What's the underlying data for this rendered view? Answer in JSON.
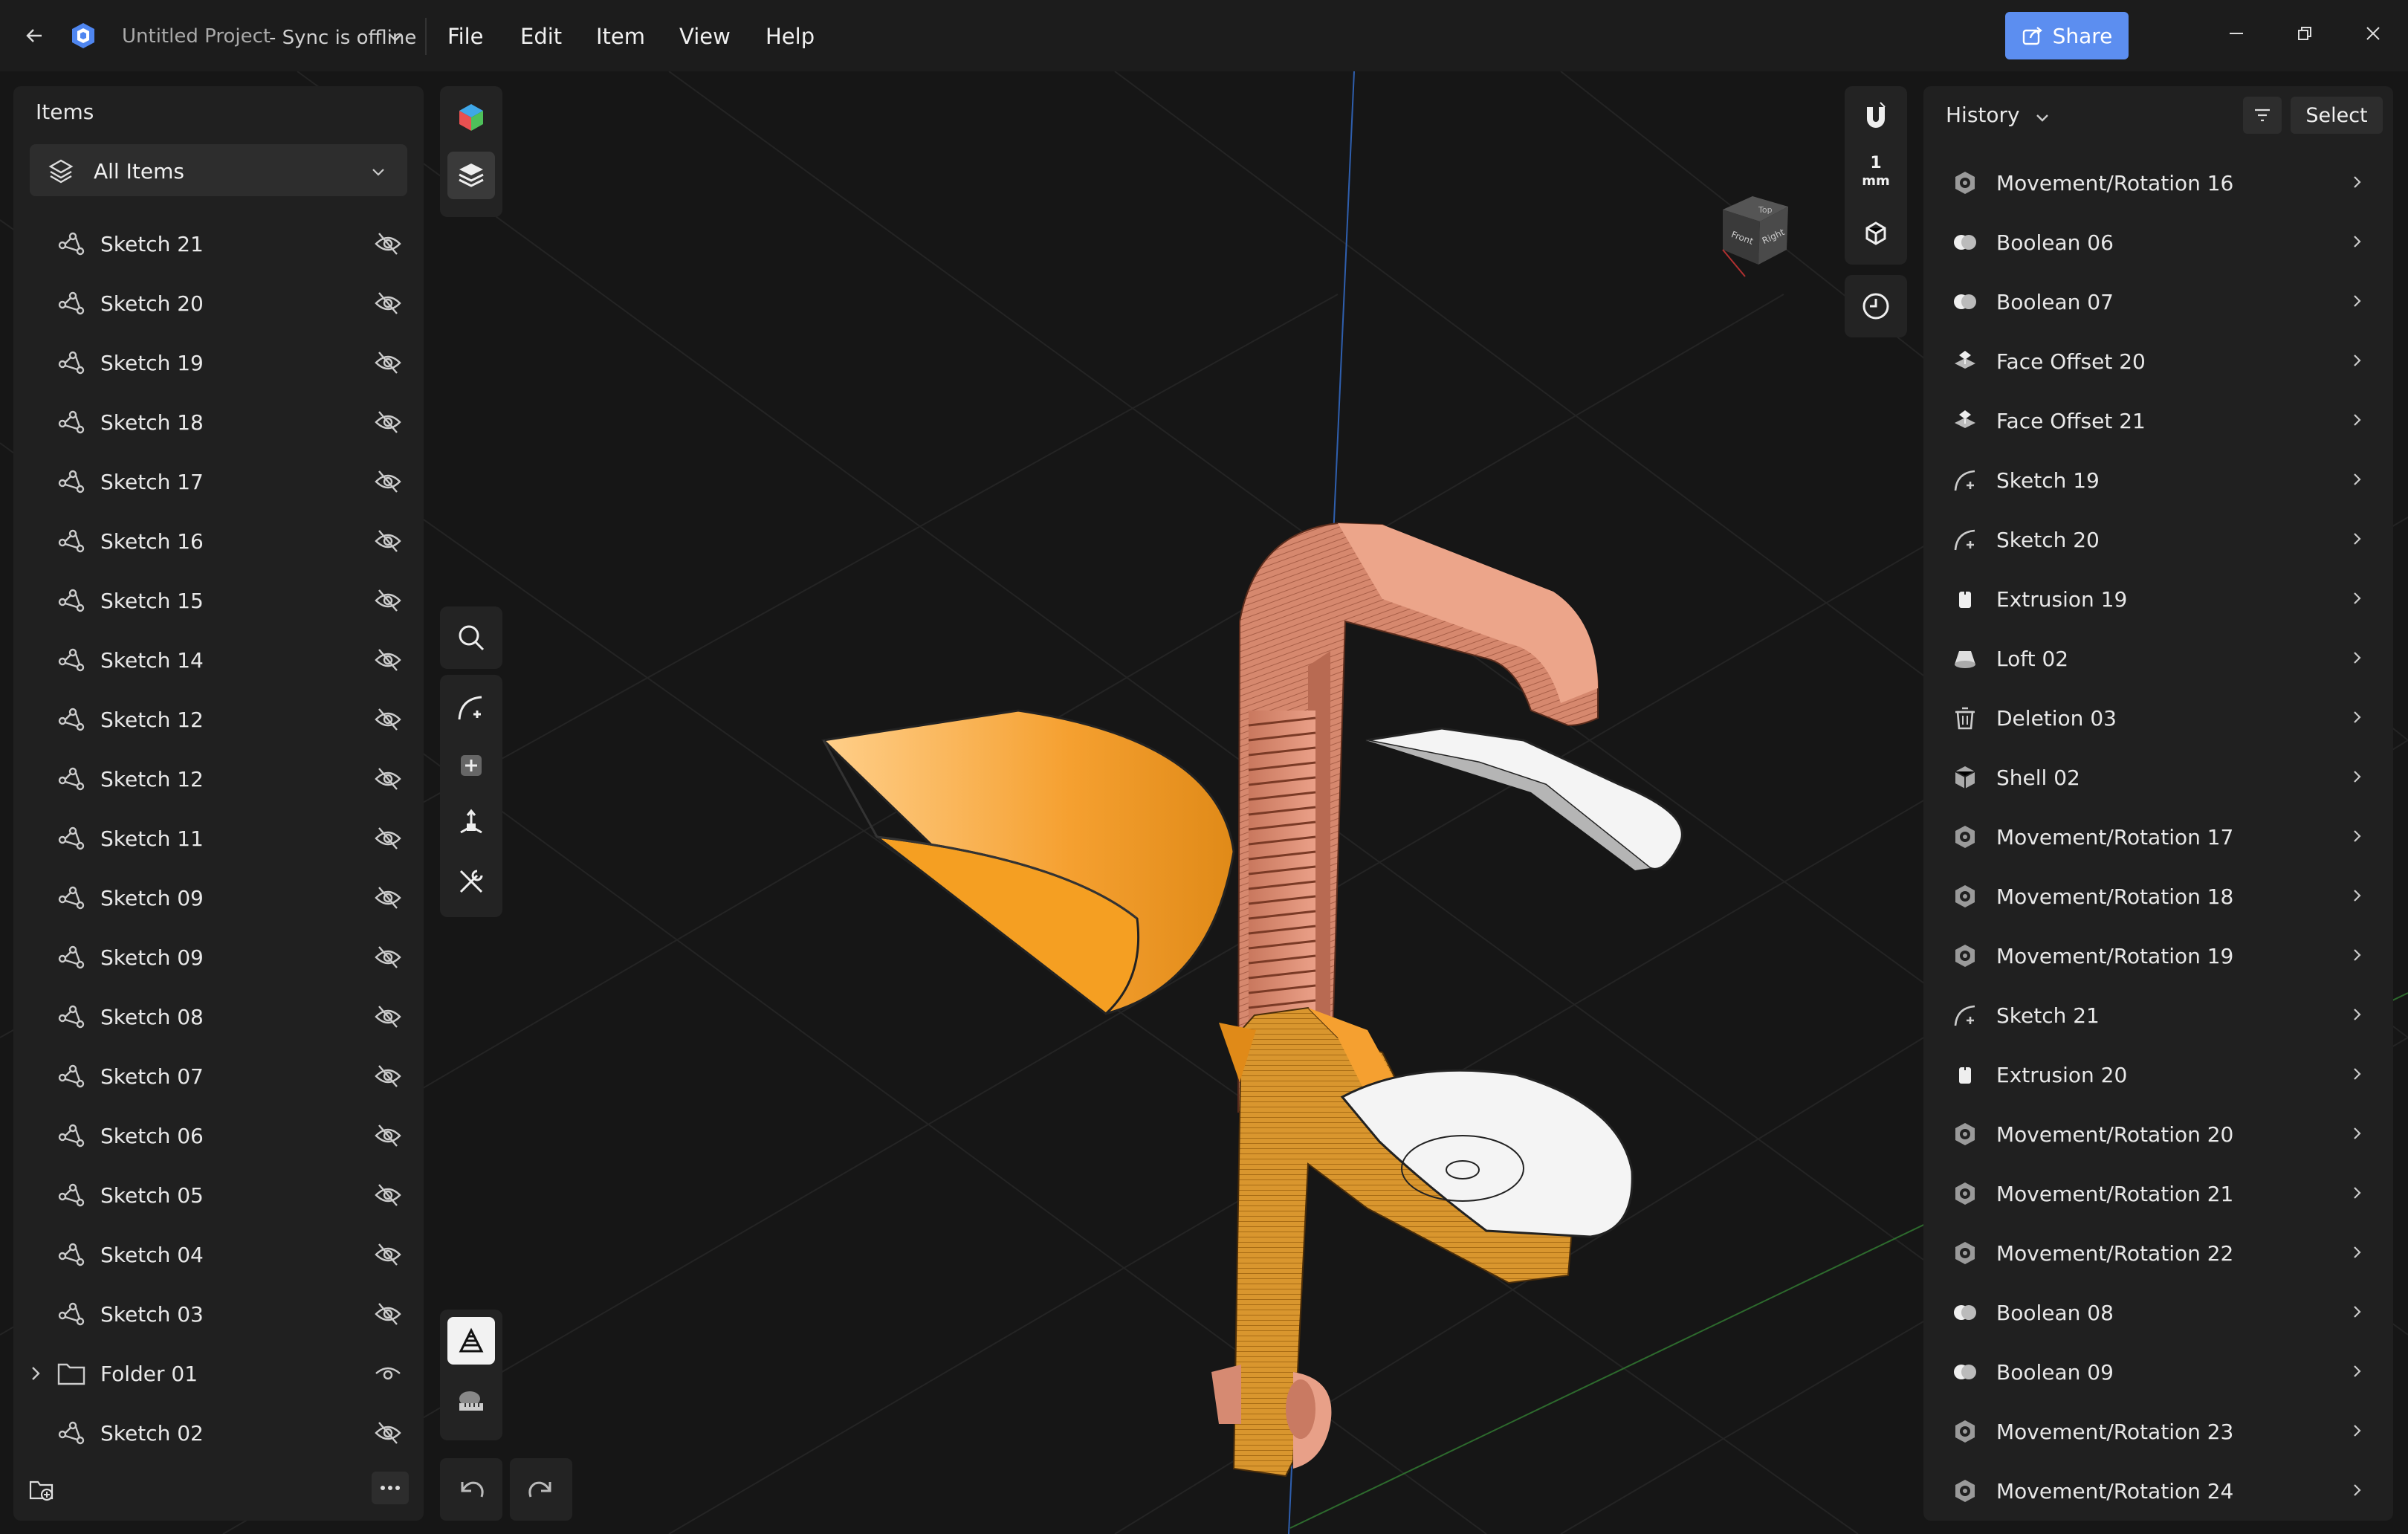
{
  "titlebar": {
    "project_name": "Untitled Project",
    "sync_status": "- Sync is offline",
    "menu": [
      "File",
      "Edit",
      "Item",
      "View",
      "Help"
    ],
    "share_label": "Share"
  },
  "left_panel": {
    "title": "Items",
    "filter_label": "All Items",
    "items": [
      {
        "label": "Sketch 21",
        "visible": false
      },
      {
        "label": "Sketch 20",
        "visible": false
      },
      {
        "label": "Sketch 19",
        "visible": false
      },
      {
        "label": "Sketch 18",
        "visible": false
      },
      {
        "label": "Sketch 17",
        "visible": false
      },
      {
        "label": "Sketch 16",
        "visible": false
      },
      {
        "label": "Sketch 15",
        "visible": false
      },
      {
        "label": "Sketch 14",
        "visible": false
      },
      {
        "label": "Sketch 12",
        "visible": false
      },
      {
        "label": "Sketch 12",
        "visible": false
      },
      {
        "label": "Sketch 11",
        "visible": false
      },
      {
        "label": "Sketch 09",
        "visible": false
      },
      {
        "label": "Sketch 09",
        "visible": false
      },
      {
        "label": "Sketch 08",
        "visible": false
      },
      {
        "label": "Sketch 07",
        "visible": false
      },
      {
        "label": "Sketch 06",
        "visible": false
      },
      {
        "label": "Sketch 05",
        "visible": false
      },
      {
        "label": "Sketch 04",
        "visible": false
      },
      {
        "label": "Sketch 03",
        "visible": false
      },
      {
        "label": "Folder 01",
        "visible": true,
        "type": "folder"
      },
      {
        "label": "Sketch 02",
        "visible": false
      }
    ]
  },
  "viewport": {
    "unit_value": "1",
    "unit_label": "mm",
    "view_cube_faces": [
      "Top",
      "Front",
      "Right"
    ]
  },
  "history_panel": {
    "title": "History",
    "select_label": "Select",
    "items": [
      {
        "label": "Movement/Rotation 16",
        "icon": "move-icon"
      },
      {
        "label": "Boolean 06",
        "icon": "boolean-icon"
      },
      {
        "label": "Boolean 07",
        "icon": "boolean-icon"
      },
      {
        "label": "Face Offset 20",
        "icon": "face-offset-icon"
      },
      {
        "label": "Face Offset 21",
        "icon": "face-offset-icon"
      },
      {
        "label": "Sketch 19",
        "icon": "sketch-icon"
      },
      {
        "label": "Sketch 20",
        "icon": "sketch-icon"
      },
      {
        "label": "Extrusion 19",
        "icon": "extrusion-icon"
      },
      {
        "label": "Loft 02",
        "icon": "loft-icon"
      },
      {
        "label": "Deletion 03",
        "icon": "trash-icon"
      },
      {
        "label": "Shell 02",
        "icon": "shell-icon"
      },
      {
        "label": "Movement/Rotation 17",
        "icon": "move-icon"
      },
      {
        "label": "Movement/Rotation 18",
        "icon": "move-icon"
      },
      {
        "label": "Movement/Rotation 19",
        "icon": "move-icon"
      },
      {
        "label": "Sketch 21",
        "icon": "sketch-icon"
      },
      {
        "label": "Extrusion 20",
        "icon": "extrusion-icon"
      },
      {
        "label": "Movement/Rotation 20",
        "icon": "move-icon"
      },
      {
        "label": "Movement/Rotation 21",
        "icon": "move-icon"
      },
      {
        "label": "Movement/Rotation 22",
        "icon": "move-icon"
      },
      {
        "label": "Boolean 08",
        "icon": "boolean-icon"
      },
      {
        "label": "Boolean 09",
        "icon": "boolean-icon"
      },
      {
        "label": "Movement/Rotation 23",
        "icon": "move-icon"
      },
      {
        "label": "Movement/Rotation 24",
        "icon": "move-icon"
      }
    ]
  },
  "colors": {
    "accent": "#5c8ef0",
    "panel": "#202020",
    "orange_model": "#f5a030",
    "copper_model": "#e8957a"
  }
}
